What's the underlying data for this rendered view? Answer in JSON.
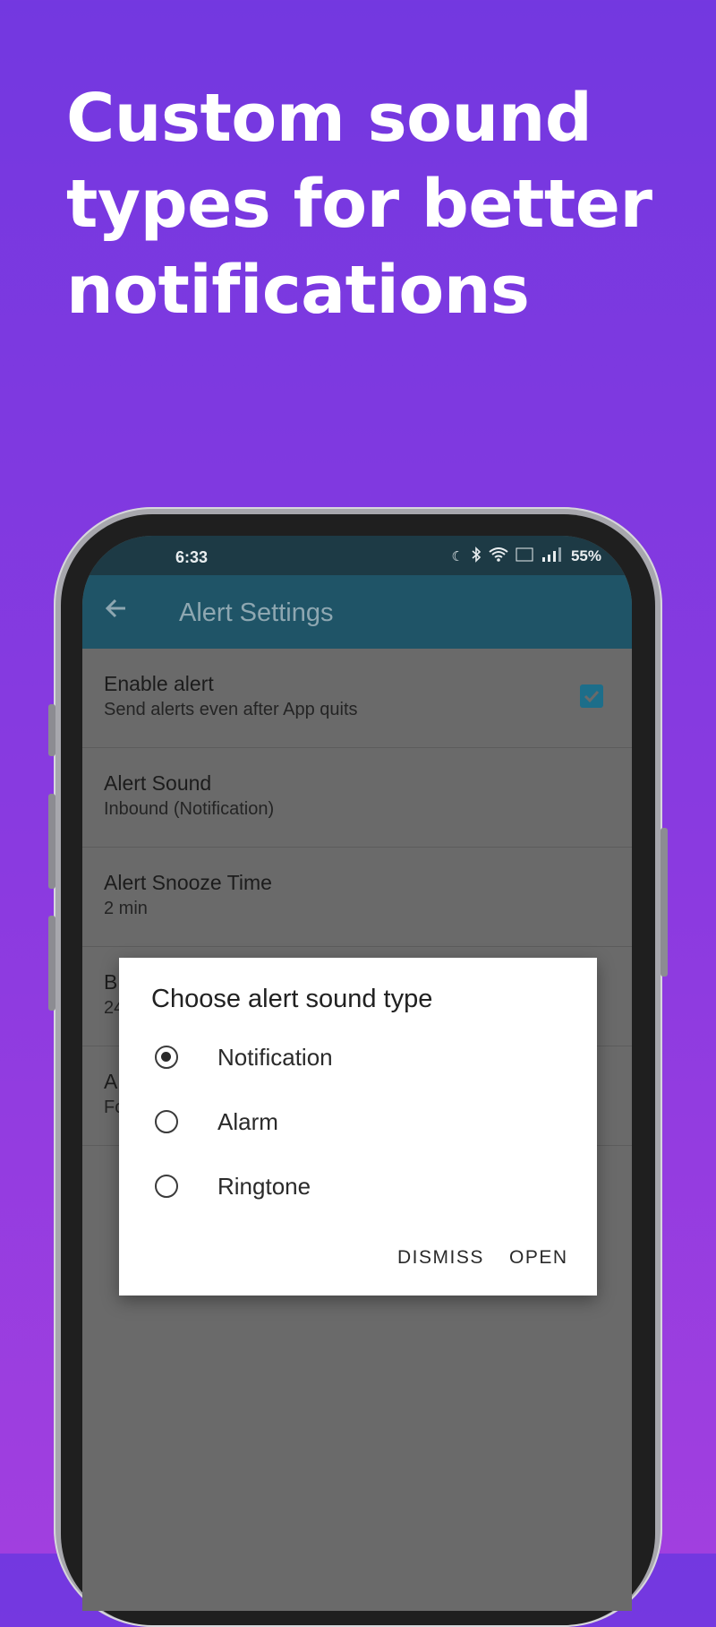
{
  "headline": [
    "Custom sound",
    "types for better",
    "notifications"
  ],
  "status_bar": {
    "time": "6:33",
    "battery": "55%"
  },
  "app_bar": {
    "title": "Alert Settings"
  },
  "settings": [
    {
      "title": "Enable alert",
      "subtitle": "Send alerts even after App quits",
      "checked": true
    },
    {
      "title": "Alert Sound",
      "subtitle": "Inbound (Notification)"
    },
    {
      "title": "Alert Snooze Time",
      "subtitle": "2 min"
    },
    {
      "title": "B",
      "subtitle": "24"
    },
    {
      "title": "A",
      "subtitle": "Fo"
    }
  ],
  "dialog": {
    "title": "Choose alert sound type",
    "options": [
      {
        "label": "Notification",
        "selected": true
      },
      {
        "label": "Alarm",
        "selected": false
      },
      {
        "label": "Ringtone",
        "selected": false
      }
    ],
    "dismiss_label": "DISMISS",
    "open_label": "OPEN"
  },
  "colors": {
    "accent": "#1f5467",
    "status_bar": "#1d3a45",
    "background_top": "#7338e0",
    "background_bottom": "#a13fdf"
  }
}
